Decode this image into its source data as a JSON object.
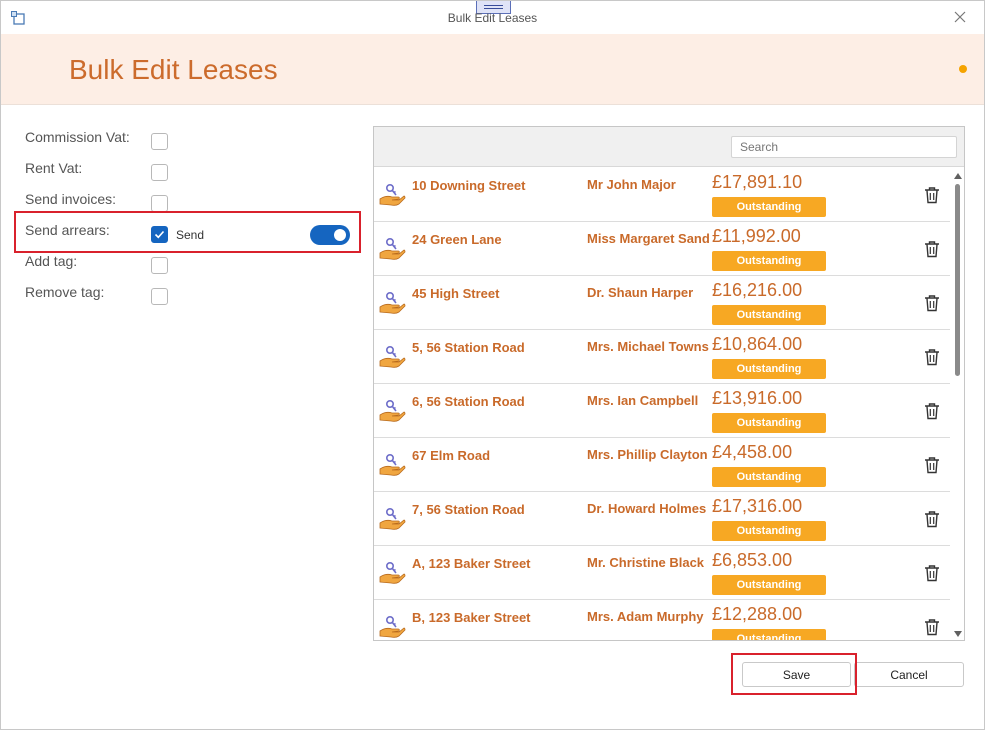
{
  "window": {
    "title": "Bulk Edit Leases"
  },
  "header": {
    "title": "Bulk Edit Leases"
  },
  "form": {
    "commission_vat": {
      "label": "Commission Vat:",
      "checked": false
    },
    "rent_vat": {
      "label": "Rent Vat:",
      "checked": false
    },
    "send_invoices": {
      "label": "Send invoices:",
      "checked": false
    },
    "send_arrears": {
      "label": "Send arrears:",
      "checked": true,
      "send_label": "Send",
      "toggle_on": true
    },
    "add_tag": {
      "label": "Add tag:",
      "checked": false
    },
    "remove_tag": {
      "label": "Remove tag:",
      "checked": false
    }
  },
  "list": {
    "search_placeholder": "Search",
    "items": [
      {
        "address": "10 Downing Street",
        "tenant": "Mr John Major",
        "amount": "£17,891.10",
        "status": "Outstanding"
      },
      {
        "address": "24 Green Lane",
        "tenant": "Miss Margaret Sanders",
        "amount": "£11,992.00",
        "status": "Outstanding"
      },
      {
        "address": "45 High Street",
        "tenant": "Dr. Shaun Harper",
        "amount": "£16,216.00",
        "status": "Outstanding"
      },
      {
        "address": "5, 56 Station Road",
        "tenant": "Mrs. Michael Townsend",
        "amount": "£10,864.00",
        "status": "Outstanding"
      },
      {
        "address": "6, 56 Station Road",
        "tenant": "Mrs. Ian Campbell",
        "amount": "£13,916.00",
        "status": "Outstanding"
      },
      {
        "address": "67 Elm Road",
        "tenant": "Mrs. Phillip Clayton",
        "amount": "£4,458.00",
        "status": "Outstanding"
      },
      {
        "address": "7, 56 Station Road",
        "tenant": "Dr. Howard Holmes",
        "amount": "£17,316.00",
        "status": "Outstanding"
      },
      {
        "address": "A, 123 Baker Street",
        "tenant": "Mr. Christine Black",
        "amount": "£6,853.00",
        "status": "Outstanding"
      },
      {
        "address": "B, 123 Baker Street",
        "tenant": "Mrs. Adam Murphy",
        "amount": "£12,288.00",
        "status": "Outstanding"
      }
    ]
  },
  "buttons": {
    "save": "Save",
    "cancel": "Cancel"
  },
  "colors": {
    "accent": "#cc6b2c",
    "header_bg": "#fdeee5",
    "badge": "#f7a823",
    "toggle": "#1565c0",
    "highlight": "#d9212c"
  }
}
